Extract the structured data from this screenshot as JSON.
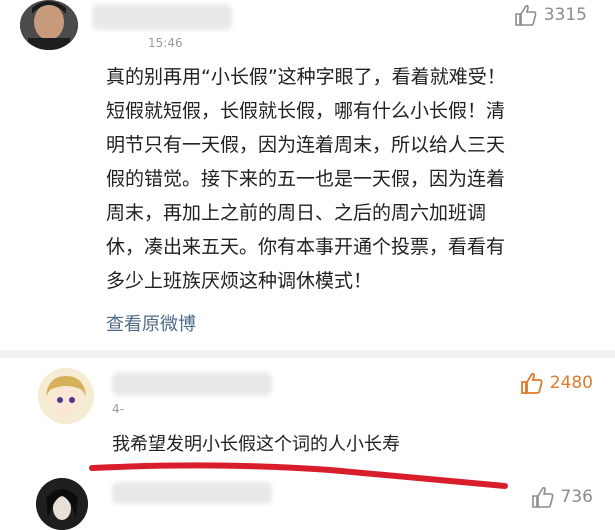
{
  "comment1": {
    "timestamp": "15:46",
    "likes": "3315",
    "text": "真的别再用“小长假”这种字眼了，看着就难受！\n短假就短假，长假就长假，哪有什么小长假！清\n明节只有一天假，因为连着周末，所以给人三天\n假的错觉。接下来的五一也是一天假，因为连着\n周末，再加上之前的周日、之后的周六加班调\n休，凑出来五天。你有本事开通个投票，看看有\n多少上班族厌烦这种调休模式！",
    "view_original": "查看原微博"
  },
  "comment2": {
    "timestamp": "4-",
    "likes": "2480",
    "text": "我希望发明小长假这个词的人小长寿"
  },
  "comment3": {
    "likes": "736"
  },
  "colors": {
    "like_active": "#e07a2a",
    "like_inactive": "#8c8c8c",
    "link": "#506a8a",
    "underline": "#d81e2a"
  }
}
